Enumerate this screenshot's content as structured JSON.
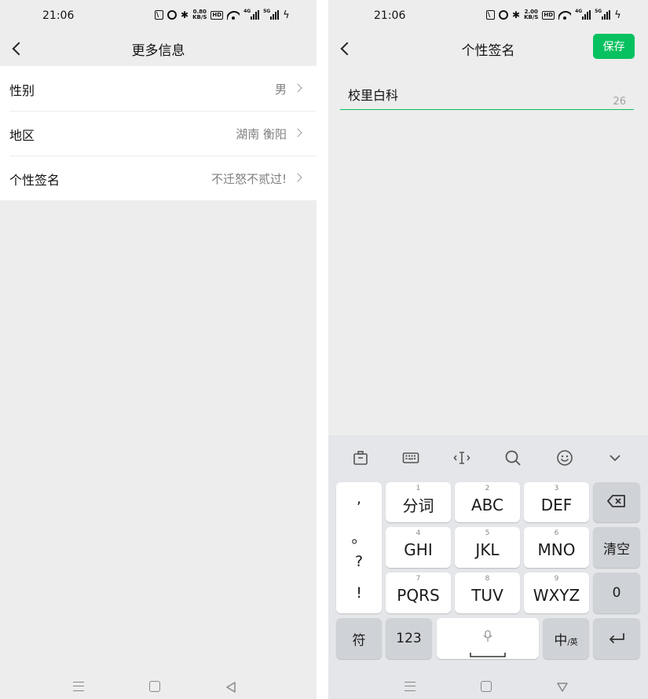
{
  "left": {
    "status": {
      "time": "21:06",
      "speed_top": "0.80",
      "speed_bottom": "KB/S",
      "hd": "HD",
      "signal1": "4G",
      "signal2": "5G"
    },
    "nav": {
      "title": "更多信息"
    },
    "rows": [
      {
        "label": "性别",
        "value": "男"
      },
      {
        "label": "地区",
        "value": "湖南 衡阳"
      },
      {
        "label": "个性签名",
        "value": "不迁怒不贰过!"
      }
    ]
  },
  "right": {
    "status": {
      "time": "21:06",
      "speed_top": "2.00",
      "speed_bottom": "KB/S",
      "hd": "HD",
      "signal1": "4G",
      "signal2": "5G"
    },
    "nav": {
      "title": "个性签名",
      "save_label": "保存"
    },
    "editor": {
      "value": "校里白科",
      "counter": "26"
    },
    "keyboard": {
      "punctuation": [
        ",",
        "。",
        "?",
        "!"
      ],
      "keys": [
        {
          "num": "1",
          "label": "分词"
        },
        {
          "num": "2",
          "label": "ABC"
        },
        {
          "num": "3",
          "label": "DEF"
        },
        {
          "num": "4",
          "label": "GHI"
        },
        {
          "num": "5",
          "label": "JKL"
        },
        {
          "num": "6",
          "label": "MNO"
        },
        {
          "num": "7",
          "label": "PQRS"
        },
        {
          "num": "8",
          "label": "TUV"
        },
        {
          "num": "9",
          "label": "WXYZ"
        }
      ],
      "clear_label": "清空",
      "zero_label": "0",
      "symbol_label": "符",
      "numeric_label": "123",
      "lang_main": "中",
      "lang_sub": "/英"
    }
  },
  "icons": {
    "back": "chevron-left-icon",
    "row_chevron": "chevron-right-icon",
    "toolbar": [
      "toolbox-icon",
      "keyboard-icon",
      "cursor-icon",
      "search-icon",
      "emoji-icon",
      "collapse-icon"
    ],
    "backspace": "backspace-icon",
    "enter": "enter-icon",
    "mic": "microphone-icon"
  },
  "colors": {
    "accent": "#07c160",
    "background": "#ededed",
    "keyboard_bg": "#e4e6e9"
  }
}
